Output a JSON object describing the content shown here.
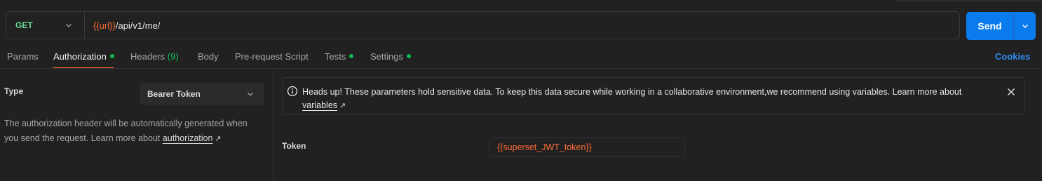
{
  "request": {
    "method": "GET",
    "url_variable": "{{url}}",
    "url_path": "/api/v1/me/",
    "send_label": "Send"
  },
  "tabs": [
    {
      "label": "Params"
    },
    {
      "label": "Authorization",
      "active": true,
      "dot": true
    },
    {
      "label": "Headers",
      "count": "(9)"
    },
    {
      "label": "Body"
    },
    {
      "label": "Pre-request Script"
    },
    {
      "label": "Tests",
      "dot": true
    },
    {
      "label": "Settings",
      "dot": true
    }
  ],
  "cookies_label": "Cookies",
  "auth": {
    "type_label": "Type",
    "type_value": "Bearer Token",
    "description_text": "The authorization header will be automatically generated when you send the request. Learn more about ",
    "description_link": "authorization",
    "notice_text": "Heads up! These parameters hold sensitive data. To keep this data secure while working in a collaborative environment,we recommend using variables. Learn more about ",
    "notice_link": "variables",
    "token_label": "Token",
    "token_value": "{{superset_JWT_token}}"
  },
  "colors": {
    "accent": "#ff6c37",
    "send_button": "#097bed",
    "status_dot": "#0cbb52",
    "link_blue": "#2f8cf0"
  }
}
